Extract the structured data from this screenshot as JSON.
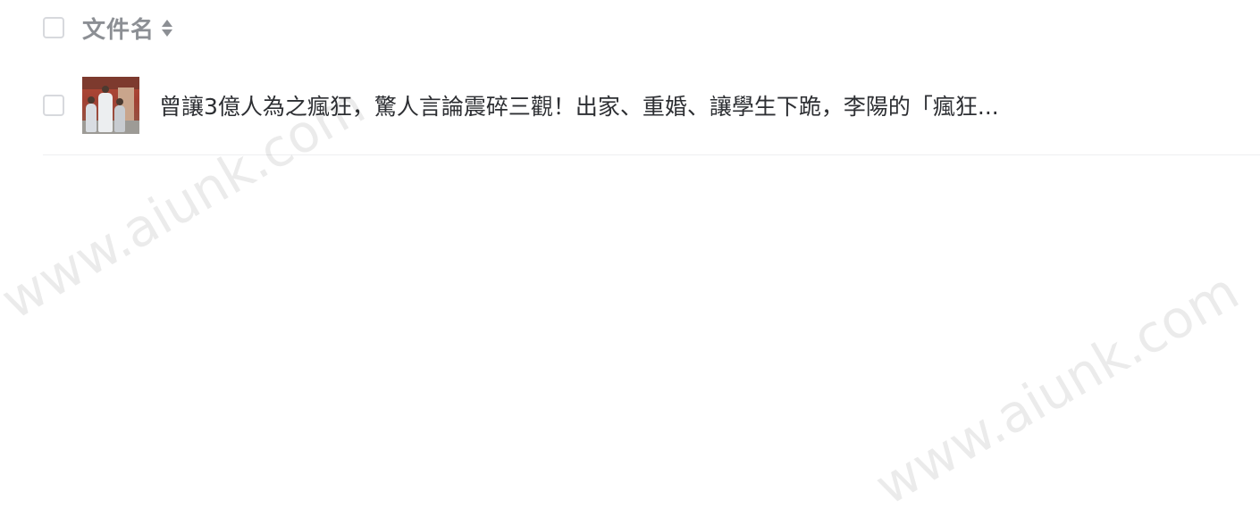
{
  "header": {
    "column_name_label": "文件名",
    "sort_icon": "sort-updown-icon"
  },
  "files": [
    {
      "name": "曾讓3億人為之瘋狂，驚人言論震碎三觀！出家、重婚、讓學生下跪，李陽的「瘋狂...",
      "thumbnail": "video-thumbnail"
    }
  ],
  "watermarks": [
    "www.aiunk.com",
    "www.aiunk.com"
  ],
  "colors": {
    "header_text": "#8c8f94",
    "file_text": "#2d2f33",
    "checkbox_border": "#d7d9dd",
    "divider": "#eeeff1"
  }
}
